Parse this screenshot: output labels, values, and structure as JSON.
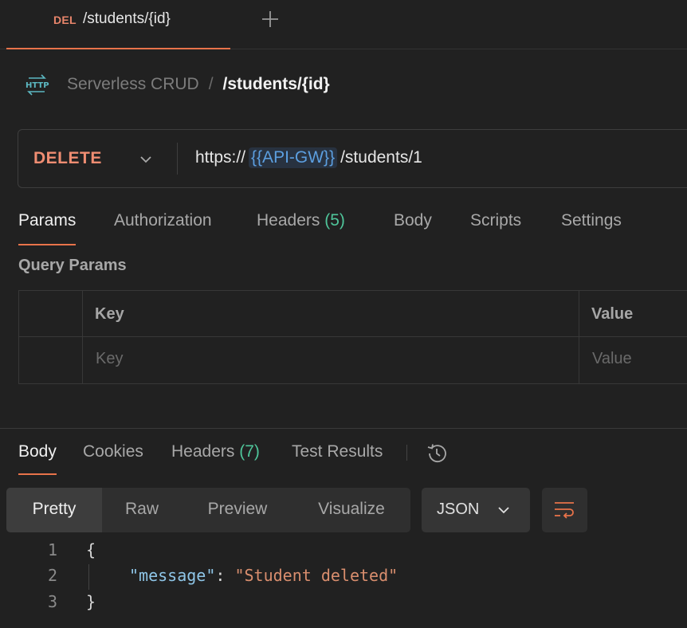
{
  "tab": {
    "method": "DEL",
    "path": "/students/{id}"
  },
  "breadcrumb": {
    "icon": "http-icon",
    "parent": "Serverless CRUD",
    "separator": "/",
    "current": "/students/{id}"
  },
  "request": {
    "method": "DELETE",
    "url_prefix": "https://",
    "url_variable": "{{API-GW}}",
    "url_suffix": "/students/1"
  },
  "request_tabs": {
    "params": "Params",
    "authorization": "Authorization",
    "headers": "Headers",
    "headers_count": "(5)",
    "body": "Body",
    "scripts": "Scripts",
    "settings": "Settings"
  },
  "query_params": {
    "title": "Query Params",
    "columns": {
      "key": "Key",
      "value": "Value"
    },
    "placeholders": {
      "key": "Key",
      "value": "Value"
    }
  },
  "response_tabs": {
    "body": "Body",
    "cookies": "Cookies",
    "headers": "Headers",
    "headers_count": "(7)",
    "test_results": "Test Results"
  },
  "view_modes": {
    "pretty": "Pretty",
    "raw": "Raw",
    "preview": "Preview",
    "visualize": "Visualize"
  },
  "format": "JSON",
  "response_body": {
    "line_numbers": [
      "1",
      "2",
      "3"
    ],
    "open_brace": "{",
    "key": "\"message\"",
    "colon": ": ",
    "value": "\"Student deleted\"",
    "close_brace": "}"
  },
  "colors": {
    "accent": "#e8734a",
    "method_delete": "#ef8d72",
    "variable": "#5c9fe0",
    "count": "#4fc59a",
    "background": "#212121"
  }
}
